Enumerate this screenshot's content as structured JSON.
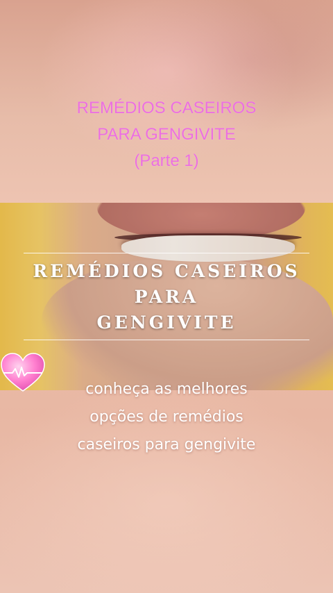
{
  "title": {
    "line1": "REMÉDIOS CASEIROS",
    "line2": "PARA GENGIVITE",
    "line3": "(Parte 1)",
    "color": "#ec6fe0"
  },
  "photo_overlay": {
    "line1": "REMÉDIOS CASEIROS",
    "line2": "PARA",
    "line3": "GENGIVITE"
  },
  "subtitle": {
    "line1": "conheça as melhores",
    "line2": "opções de remédios",
    "line3": "caseiros para gengivite"
  },
  "icons": {
    "heart": "heart-pulse-icon"
  }
}
